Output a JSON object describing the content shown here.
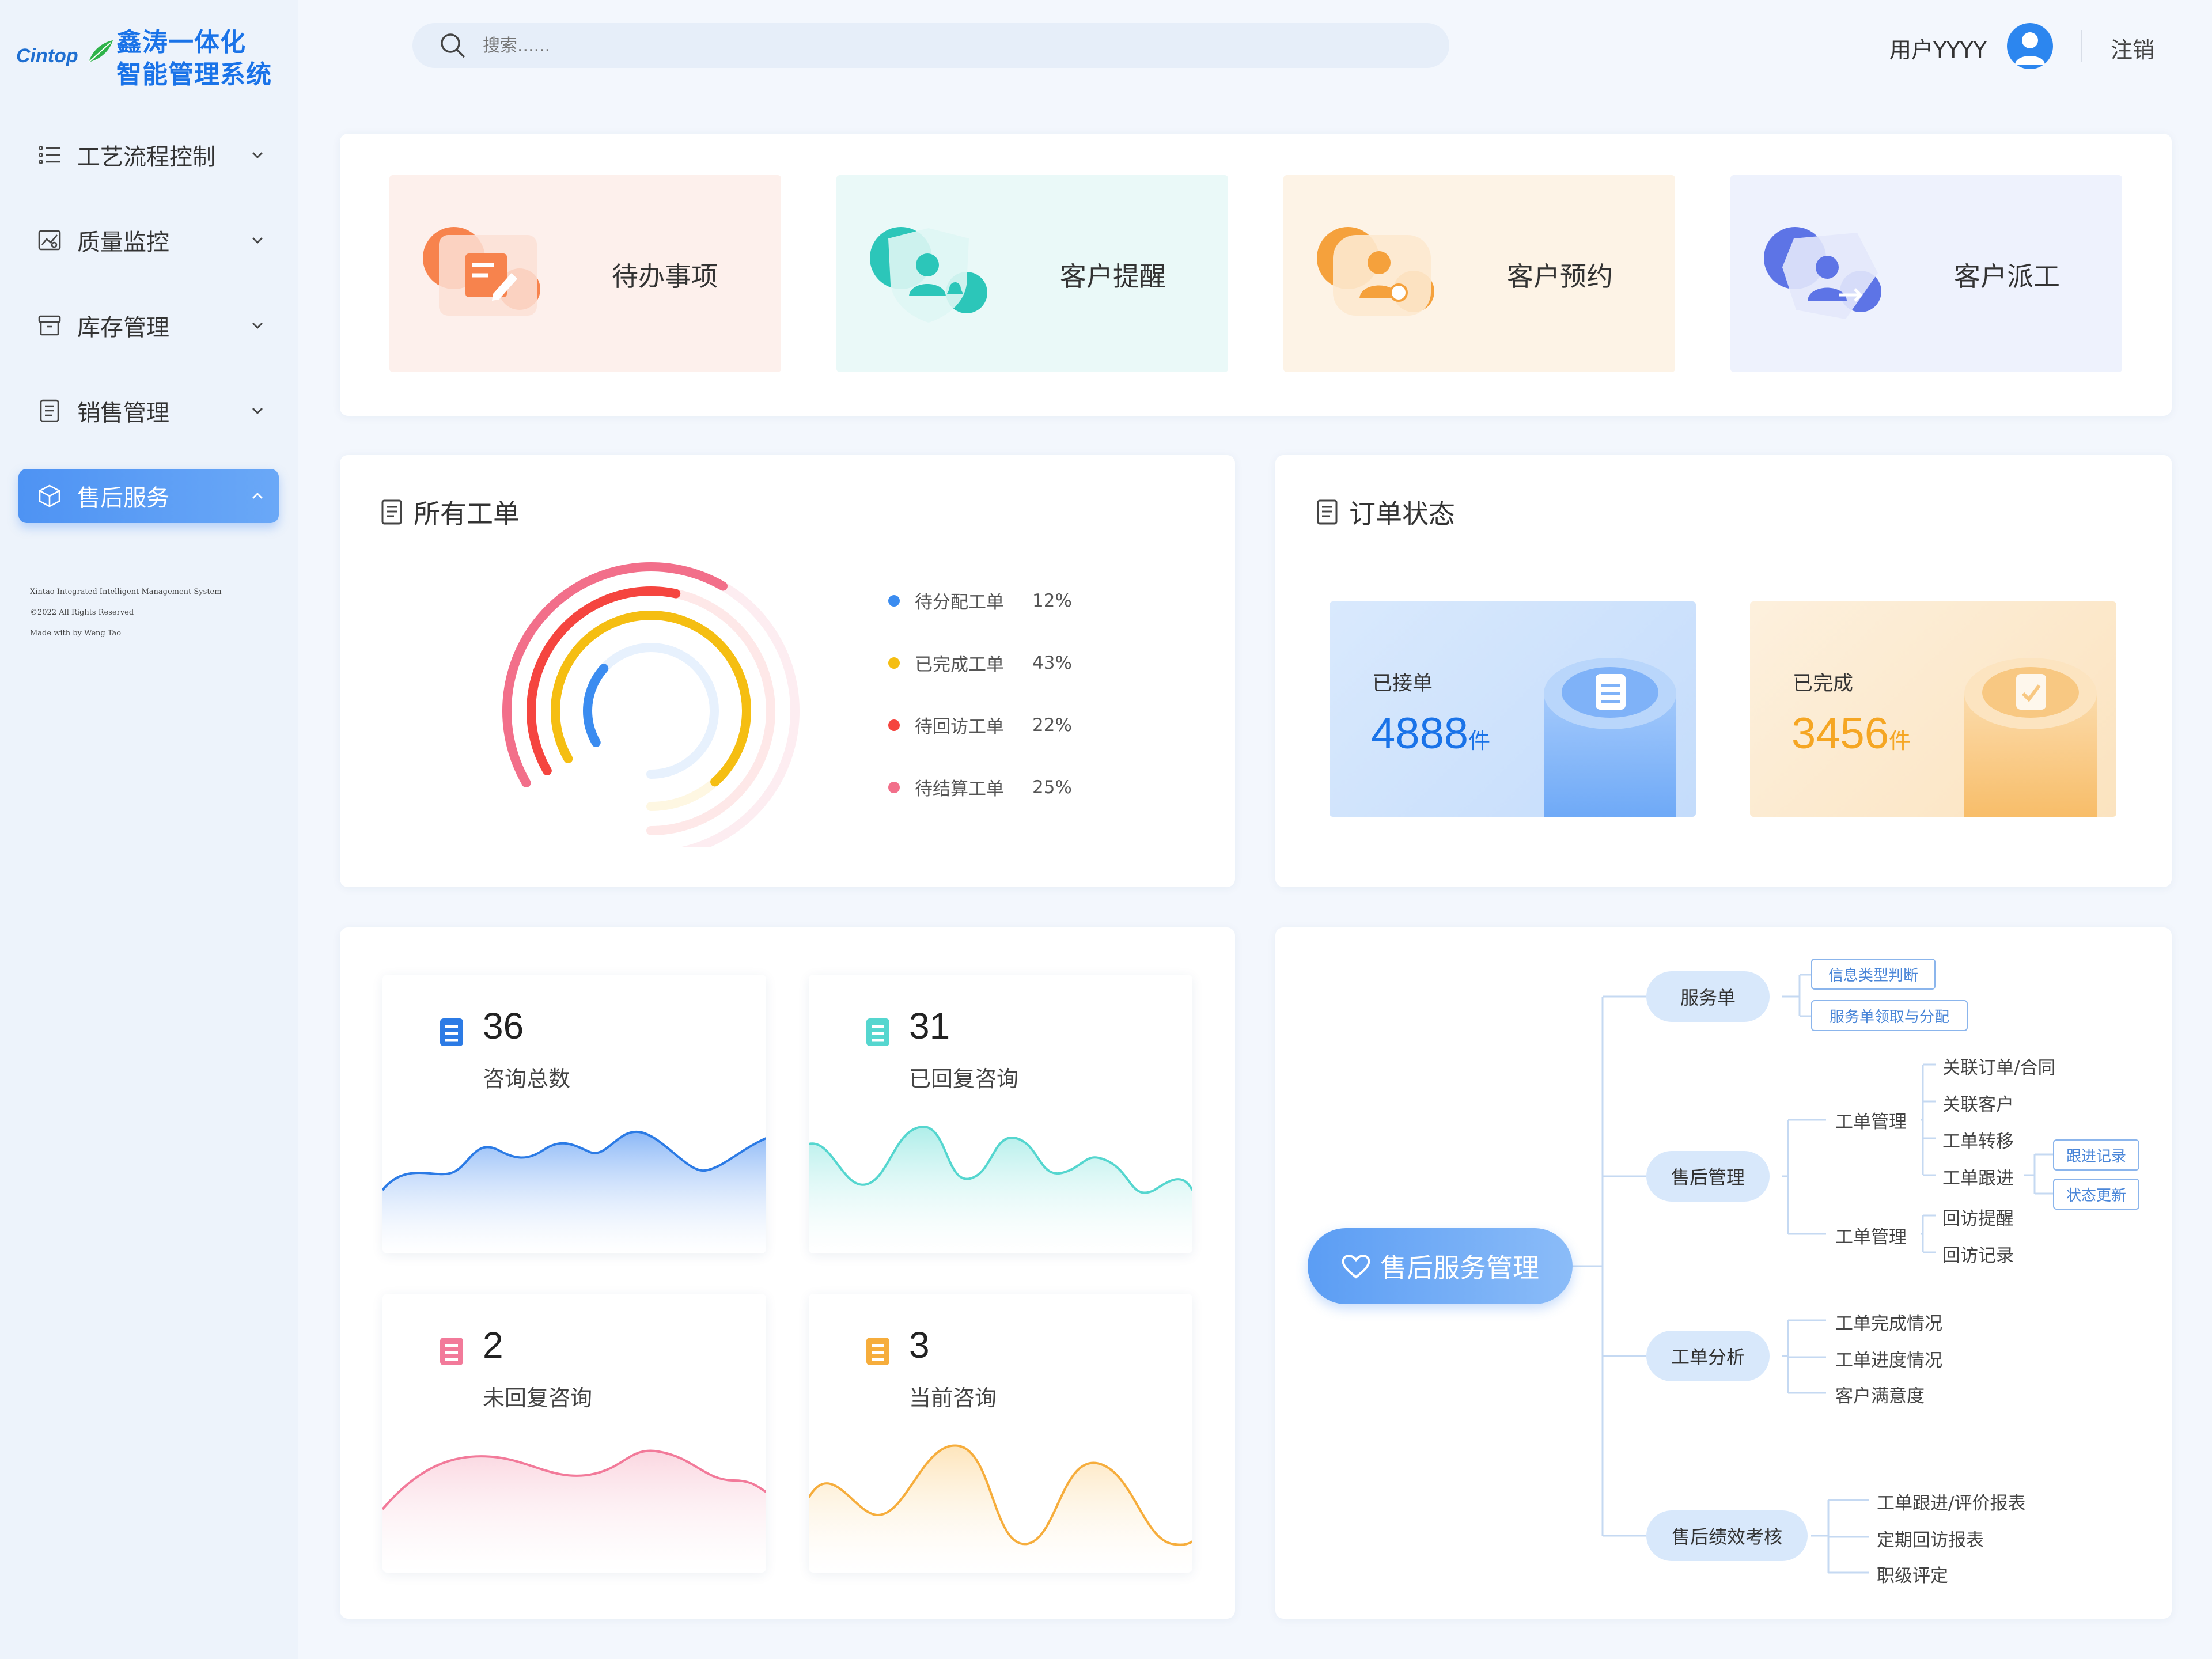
{
  "app": {
    "brand": "Cintop",
    "title_line1": "鑫涛一体化",
    "title_line2": "智能管理系统"
  },
  "sidebar": {
    "items": [
      {
        "label": "工艺流程控制",
        "icon": "list-icon"
      },
      {
        "label": "质量监控",
        "icon": "chart-image-icon"
      },
      {
        "label": "库存管理",
        "icon": "archive-icon"
      },
      {
        "label": "销售管理",
        "icon": "document-list-icon"
      },
      {
        "label": "售后服务",
        "icon": "box-icon",
        "active": true
      }
    ],
    "footer": [
      "Xintao Integrated Intelligent Management System",
      "©2022 All Rights Reserved",
      "Made with by Weng Tao"
    ]
  },
  "header": {
    "search_placeholder": "搜索......",
    "user_name": "用户YYYY",
    "logout_label": "注销"
  },
  "quick_actions": [
    {
      "label": "待办事项",
      "color": "#f7834d"
    },
    {
      "label": "客户提醒",
      "color": "#2cc6b9"
    },
    {
      "label": "客户预约",
      "color": "#f5a13c"
    },
    {
      "label": "客户派工",
      "color": "#5d74e6"
    }
  ],
  "work_orders": {
    "title": "所有工单",
    "legend": [
      {
        "label": "待分配工单",
        "pct": "12%",
        "value": 12,
        "color": "#3b8cf0"
      },
      {
        "label": "已完成工单",
        "pct": "43%",
        "value": 43,
        "color": "#f5be12"
      },
      {
        "label": "待回访工单",
        "pct": "22%",
        "value": 22,
        "color": "#f5453f"
      },
      {
        "label": "待结算工单",
        "pct": "25%",
        "value": 25,
        "color": "#f26f8a"
      }
    ]
  },
  "order_status": {
    "title": "订单状态",
    "received": {
      "label": "已接单",
      "value": "4888",
      "unit": "件",
      "color": "#1a73e8"
    },
    "completed": {
      "label": "已完成",
      "value": "3456",
      "unit": "件",
      "color": "#f5a623"
    }
  },
  "consult": [
    {
      "value": "36",
      "label": "咨询总数",
      "color": "#2c7be5"
    },
    {
      "value": "31",
      "label": "已回复咨询",
      "color": "#55d6cf"
    },
    {
      "value": "2",
      "label": "未回复咨询",
      "color": "#f27a9a"
    },
    {
      "value": "3",
      "label": "当前咨询",
      "color": "#f6ad3c"
    }
  ],
  "mindmap": {
    "root": "售后服务管理",
    "branches": {
      "service_order": {
        "label": "服务单",
        "tags": [
          "信息类型判断",
          "服务单领取与分配"
        ]
      },
      "after_sales": {
        "label": "售后管理",
        "group1_label": "工单管理",
        "group1_items": [
          "关联订单/合同",
          "关联客户",
          "工单转移",
          "工单跟进"
        ],
        "followup_tags": [
          "跟进记录",
          "状态更新"
        ],
        "group2_label": "工单管理",
        "group2_items": [
          "回访提醒",
          "回访记录"
        ]
      },
      "analysis": {
        "label": "工单分析",
        "items": [
          "工单完成情况",
          "工单进度情况",
          "客户满意度"
        ]
      },
      "performance": {
        "label": "售后绩效考核",
        "items": [
          "工单跟进/评价报表",
          "定期回访报表",
          "职级评定"
        ]
      }
    }
  }
}
